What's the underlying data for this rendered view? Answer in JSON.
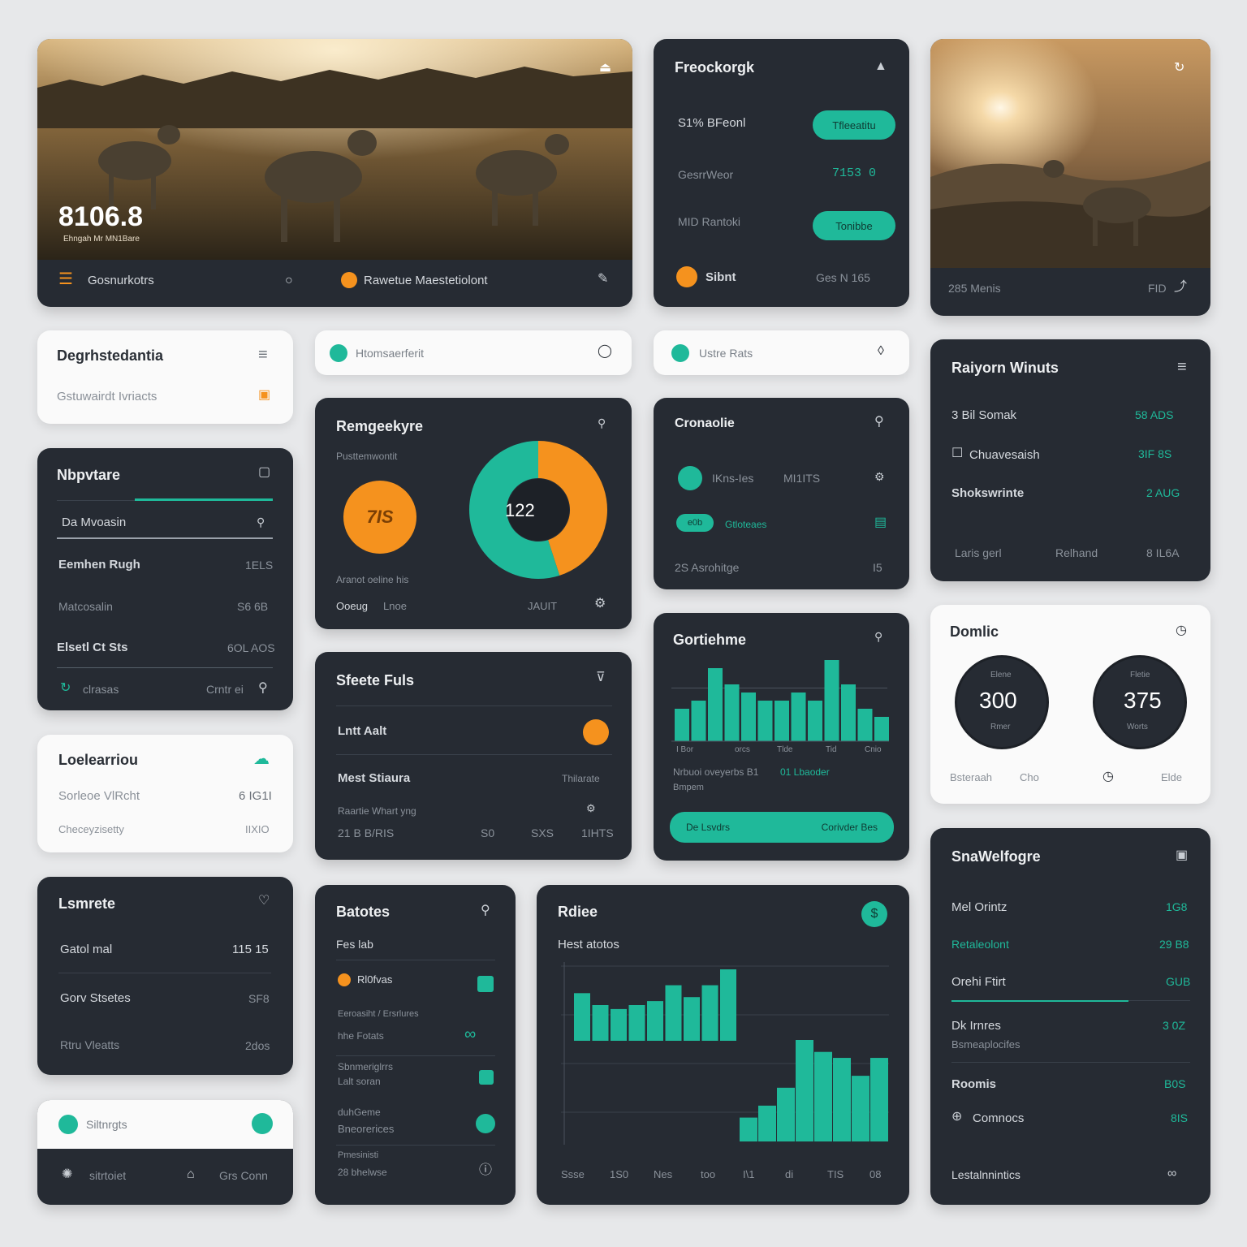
{
  "colors": {
    "teal": "#1fb99a",
    "orange": "#f5921e",
    "dark": "#262b33",
    "light": "#fafafa"
  },
  "hero": {
    "value": "8106.8",
    "caption": "Ehngah Mr MN1Bare",
    "footer_left": "Gosnurkotrs",
    "footer_mid": "Rawetue Maestetiolont"
  },
  "fb": {
    "title": "Freockorgk",
    "r1": "S1% BFeonl",
    "b1": "Tfleeatitu",
    "r2": "GesrrWeor",
    "r2v": "7153 0",
    "r3": "MID Rantoki",
    "b2": "Tonibbe",
    "r4": "Sibnt",
    "r4v": "Ges N 165"
  },
  "sunset": {
    "footer_left": "285 Menis",
    "footer_right": "FID"
  },
  "deg": {
    "title": "Degrhstedantia",
    "sub": "Gstuwairdt Ivriacts"
  },
  "pill1": {
    "label": "Htomsaerferit"
  },
  "pill2": {
    "label": "Ustre Rats"
  },
  "rw": {
    "title": "Raiyorn Winuts",
    "rows": [
      {
        "label": "3 Bil Somak",
        "value": "58 ADS"
      },
      {
        "label": "Chuavesaish",
        "value": "3IF 8S"
      },
      {
        "label": "Shokswrinte",
        "value": "2 AUG"
      }
    ],
    "f1": "Laris gerl",
    "f2": "Relhand",
    "f3": "8 IL6A"
  },
  "nb": {
    "title": "Nbpvtare",
    "input": "Da Mvoasin",
    "rows": [
      {
        "label": "Eemhen Rugh",
        "value": "1ELS"
      },
      {
        "label": "Matcosalin",
        "value": "S6 6B"
      },
      {
        "label": "Elsetl Ct Sts",
        "value": "6OL AOS"
      }
    ],
    "f1": "clrasas",
    "f2": "Crntr ei"
  },
  "donut": {
    "title": "Remgeekyre",
    "sub": "Pusttemwontit",
    "badge": "7IS",
    "center": "122",
    "f1": "Aranot oeline his",
    "f2": "Ooeug",
    "f3": "Lnoe",
    "f4": "JAUIT",
    "split": 0.55
  },
  "cron": {
    "title": "Cronaolie",
    "r1": "IKns-Ies",
    "r1b": "MI1ITS",
    "badge": "e0b",
    "r2": "Gtloteaes",
    "r3": "2S Asrohitge",
    "r3v": "I5"
  },
  "dom": {
    "title": "Domlic",
    "c1": "300",
    "c1a": "Elene",
    "c1b": "Rmer",
    "c2": "375",
    "c2a": "Fletie",
    "c2b": "Worts",
    "f1": "Bsteraah",
    "f2": "Cho",
    "f3": "Elde"
  },
  "loc": {
    "title": "Loelearriou",
    "r1": "Sorleoe VlRcht",
    "r1v": "6 IG1I",
    "r2": "Checeyzisetty",
    "r2v": "IIXIO"
  },
  "sf": {
    "title": "Sfeete Fuls",
    "r1": "Lntt Aalt",
    "r2": "Mest Stiaura",
    "r2v": "Thilarate",
    "r3": "Raartie Whart yng",
    "f1": "21 B B/RIS",
    "f2": "S0",
    "f3": "SXS",
    "f4": "1IHTS"
  },
  "cg": {
    "title": "Gortiehme",
    "xlabels": [
      "I Bor",
      "orcs",
      "Tlde",
      "Tid",
      "Cnio"
    ],
    "f1": "Nrbuoi oveyerbs B1",
    "f2": "01 Lbaoder",
    "f3": "Bmpem",
    "btn_l": "De Lsvdrs",
    "btn_r": "Corivder Bes"
  },
  "lr": {
    "title": "Lsmrete",
    "rows": [
      {
        "label": "Gatol mal",
        "value": "115 15"
      },
      {
        "label": "Gorv Stsetes",
        "value": "SF8"
      },
      {
        "label": "Rtru Vleatts",
        "value": "2dos"
      }
    ]
  },
  "sig": {
    "label": "Siltnrgts",
    "f1": "sitrtoiet",
    "f2": "Grs Conn"
  },
  "bat": {
    "title": "Batotes",
    "sub": "Fes lab",
    "r1": "Rl0fvas",
    "r2a": "Eeroasiht / Ersrlures",
    "r2b": "hhe Fotats",
    "r3a": "Sbnmeriglrrs",
    "r3b": "Lalt soran",
    "r4a": "duhGeme",
    "r4b": "Bneorerices",
    "r5a": "Pmesinisti",
    "r5b": "28 bhelwse"
  },
  "rd": {
    "title": "Rdiee",
    "sub": "Hest atotos",
    "f": [
      "Ssse",
      "1S0",
      "Nes",
      "too",
      "I\\1",
      "di",
      "TIS",
      "08"
    ]
  },
  "sw": {
    "title": "SnaWelfogre",
    "rows": [
      {
        "label": "Mel Orintz",
        "value": "1G8"
      },
      {
        "label": "Retaleolont",
        "value": "29 B8"
      },
      {
        "label": "Orehi Ftirt",
        "value": "GUB"
      },
      {
        "label": "Dk Irnres",
        "value": "3 0Z"
      },
      {
        "label": "Bsmeaplocifes",
        "value": ""
      },
      {
        "label": "Roomis",
        "value": "B0S"
      },
      {
        "label": "Comnocs",
        "value": "8IS"
      }
    ],
    "footer": "Lestalnnintics"
  },
  "chart_data": [
    {
      "type": "bar",
      "title": "Gortiehme",
      "categories": [
        "I Bor",
        "orcs",
        "Tlde",
        "Tid",
        "Cnio"
      ],
      "values": [
        4,
        5,
        9,
        7,
        6,
        5,
        5,
        6,
        5,
        10,
        7,
        4,
        3
      ]
    },
    {
      "type": "bar",
      "title": "Hest atotos",
      "values": [
        6,
        4.5,
        4,
        4.5,
        5,
        7,
        5.5,
        7,
        9
      ]
    },
    {
      "type": "bar",
      "values": [
        2,
        3,
        4.5,
        8.5,
        7.5,
        7,
        5.5,
        7
      ]
    },
    {
      "type": "pie",
      "values": [
        45,
        55
      ],
      "labels": [
        "orange",
        "teal"
      ],
      "center_label": "122"
    }
  ]
}
